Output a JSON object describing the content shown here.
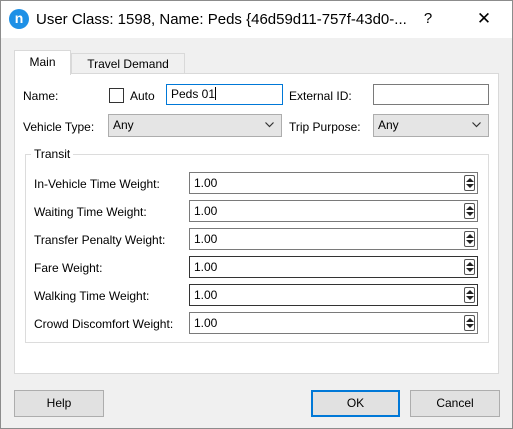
{
  "window": {
    "title": "User Class: 1598, Name: Peds  {46d59d11-757f-43d0-...",
    "app_icon_letter": "n",
    "help_glyph": "?",
    "close_glyph": "✕"
  },
  "tabs": [
    {
      "label": "Main",
      "active": true
    },
    {
      "label": "Travel Demand",
      "active": false
    }
  ],
  "main": {
    "name_label": "Name:",
    "auto_label": "Auto",
    "auto_checked": false,
    "name_value": "Peds 01",
    "external_id_label": "External ID:",
    "external_id_value": "",
    "vehicle_type_label": "Vehicle Type:",
    "vehicle_type_value": "Any",
    "trip_purpose_label": "Trip Purpose:",
    "trip_purpose_value": "Any"
  },
  "transit": {
    "group_label": "Transit",
    "rows": [
      {
        "label": "In-Vehicle Time Weight:",
        "value": "1.00"
      },
      {
        "label": "Waiting Time Weight:",
        "value": "1.00"
      },
      {
        "label": "Transfer Penalty Weight:",
        "value": "1.00"
      },
      {
        "label": "Fare Weight:",
        "value": "1.00"
      },
      {
        "label": "Walking Time Weight:",
        "value": "1.00"
      },
      {
        "label": "Crowd Discomfort Weight:",
        "value": "1.00"
      }
    ]
  },
  "buttons": {
    "help": "Help",
    "ok": "OK",
    "cancel": "Cancel"
  },
  "colors": {
    "accent": "#0078d7",
    "app_icon": "#1e90e6"
  }
}
